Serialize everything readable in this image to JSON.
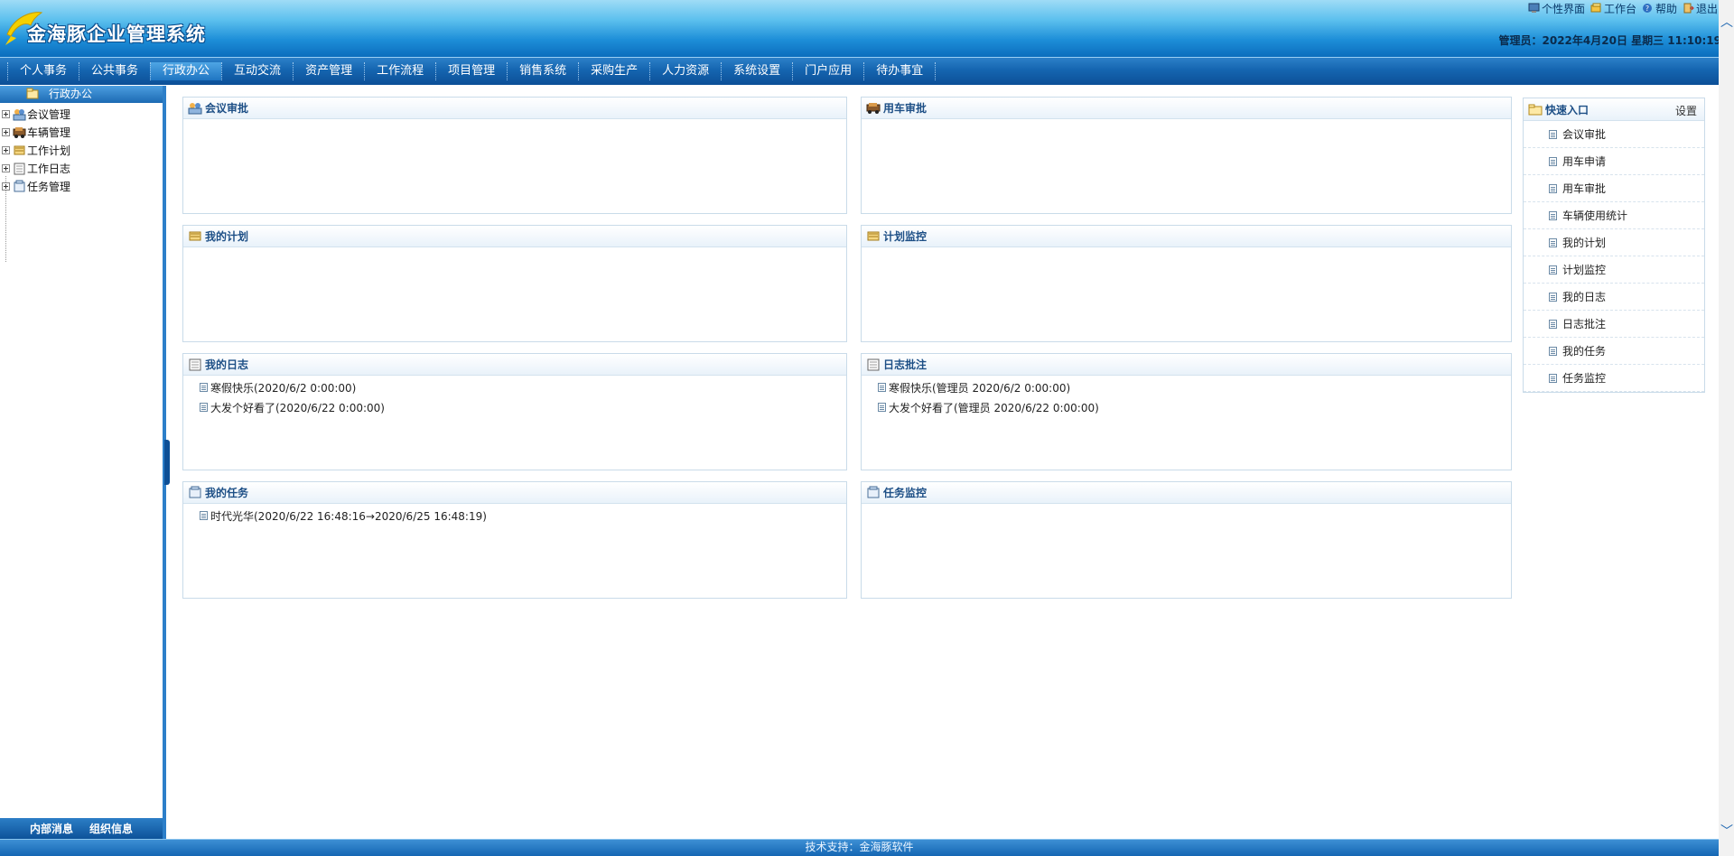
{
  "header": {
    "app_title": "金海豚企业管理系统",
    "links": [
      {
        "label": "个性界面",
        "icon": "theme-icon"
      },
      {
        "label": "工作台",
        "icon": "desk-icon"
      },
      {
        "label": "帮助",
        "icon": "help-icon"
      },
      {
        "label": "退出",
        "icon": "exit-icon"
      }
    ],
    "user_info": "管理员：2022年4月20日 星期三 11:10:19"
  },
  "nav": {
    "items": [
      "个人事务",
      "公共事务",
      "行政办公",
      "互动交流",
      "资产管理",
      "工作流程",
      "项目管理",
      "销售系统",
      "采购生产",
      "人力资源",
      "系统设置",
      "门户应用",
      "待办事宜"
    ],
    "active": "行政办公"
  },
  "sidebar": {
    "title": "行政办公",
    "tree": [
      {
        "label": "会议管理",
        "icon": "meeting-icon"
      },
      {
        "label": "车辆管理",
        "icon": "car-icon"
      },
      {
        "label": "工作计划",
        "icon": "plan-icon"
      },
      {
        "label": "工作日志",
        "icon": "log-icon"
      },
      {
        "label": "任务管理",
        "icon": "task-icon"
      }
    ],
    "footer": [
      "内部消息",
      "组织信息"
    ]
  },
  "panels": {
    "meeting_approval": {
      "title": "会议审批",
      "rows": []
    },
    "car_approval": {
      "title": "用车审批",
      "rows": []
    },
    "my_plan": {
      "title": "我的计划",
      "rows": []
    },
    "plan_monitor": {
      "title": "计划监控",
      "rows": []
    },
    "my_log": {
      "title": "我的日志",
      "rows": [
        "寒假快乐(2020/6/2 0:00:00)",
        "大发个好看了(2020/6/22 0:00:00)"
      ]
    },
    "log_annotation": {
      "title": "日志批注",
      "rows": [
        "寒假快乐(管理员 2020/6/2 0:00:00)",
        "大发个好看了(管理员 2020/6/22 0:00:00)"
      ]
    },
    "my_task": {
      "title": "我的任务",
      "rows": [
        "时代光华(2020/6/22 16:48:16→2020/6/25 16:48:19)"
      ]
    },
    "task_monitor": {
      "title": "任务监控",
      "rows": []
    }
  },
  "quick": {
    "title": "快速入口",
    "settings": "设置",
    "items": [
      "会议审批",
      "用车申请",
      "用车审批",
      "车辆使用统计",
      "我的计划",
      "计划监控",
      "我的日志",
      "日志批注",
      "我的任务",
      "任务监控"
    ]
  },
  "footer": {
    "text": "技术支持：金海豚软件"
  },
  "colors": {
    "brand_blue": "#1565b0",
    "title_blue": "#1d4f86",
    "header_light": "#5cc0ee"
  }
}
